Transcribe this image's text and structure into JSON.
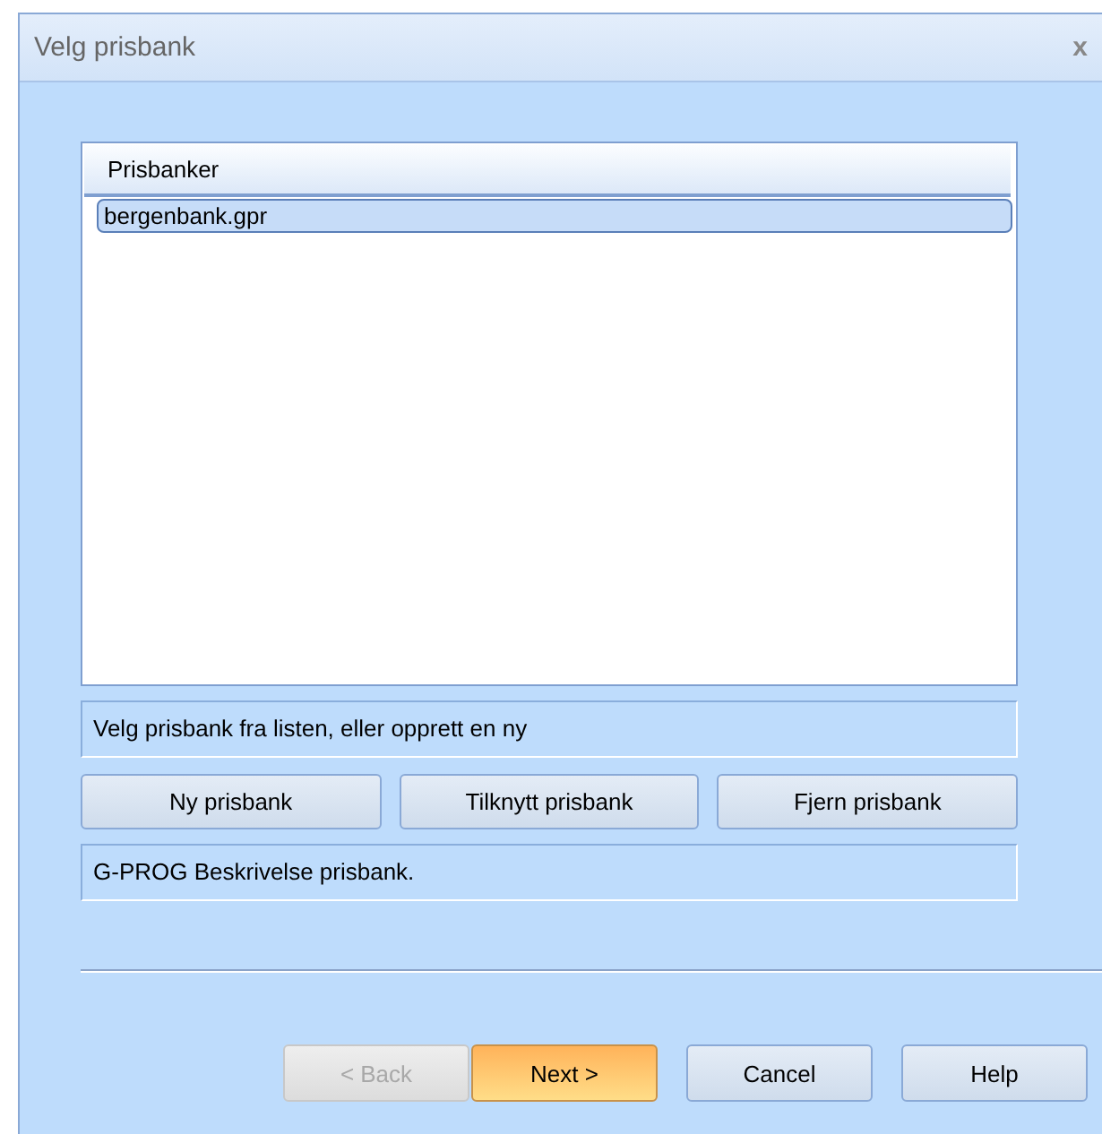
{
  "window": {
    "title": "Velg prisbank",
    "close": "x"
  },
  "list": {
    "column": "Prisbanker",
    "items": [
      {
        "label": "bergenbank.gpr",
        "selected": true
      }
    ]
  },
  "hint": "Velg prisbank fra listen, eller opprett en ny",
  "actions": [
    "Ny prisbank",
    "Tilknytt prisbank",
    "Fjern prisbank"
  ],
  "description": "G-PROG Beskrivelse prisbank.",
  "buttons": [
    {
      "label": "< Back",
      "disabled": true,
      "default": false
    },
    {
      "label": "Next >",
      "disabled": false,
      "default": true
    },
    {
      "label": "Cancel",
      "disabled": false,
      "default": false
    },
    {
      "label": "Help",
      "disabled": false,
      "default": false
    }
  ]
}
